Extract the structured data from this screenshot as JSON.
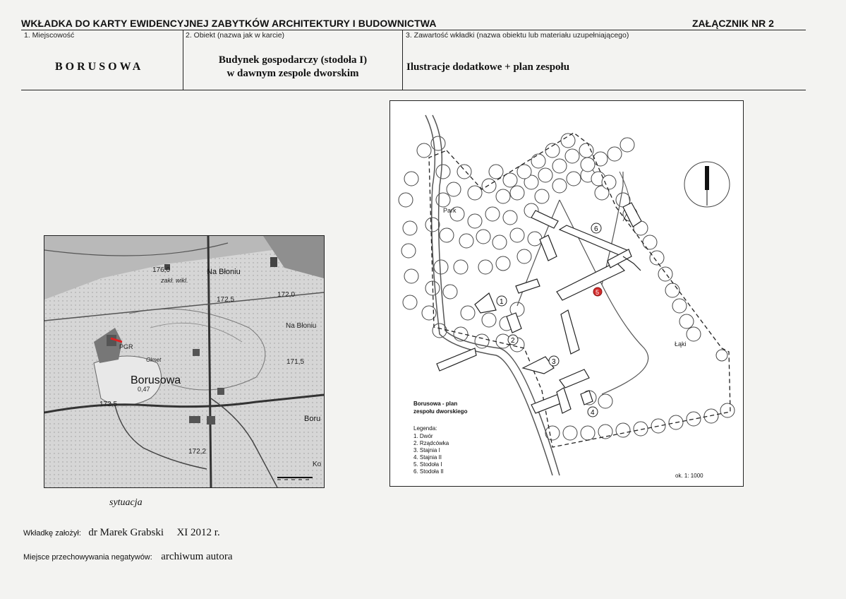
{
  "header": {
    "title": "WKŁADKA DO KARTY EWIDENCYJNEJ ZABYTKÓW ARCHITEKTURY I BUDOWNICTWA",
    "annex": "ZAŁĄCZNIK NR 2"
  },
  "fields": {
    "locality_label": "1. Miejscowość",
    "locality_value": "BORUSOWA",
    "object_label": "2. Obiekt (nazwa jak w karcie)",
    "object_line1": "Budynek gospodarczy (stodoła I)",
    "object_line2": "w dawnym zespole dworskim",
    "content_label": "3. Zawartość wkładki (nazwa obiektu lub materiału uzupełniającego)",
    "content_value": "Ilustracje dodatkowe + plan zespołu"
  },
  "situation_map": {
    "caption": "sytuacja",
    "labels": {
      "elev_176": "176,0",
      "zakl": "zakł. wikl.",
      "na_bloniu_1": "Na Błoniu",
      "elev_172_5a": "172,5",
      "elev_172_0": "172,0",
      "na_bloniu_2": "Na Błoniu",
      "pgr": "PGR",
      "olmet": "Olmet",
      "elev_171_5": "171,5",
      "borusowa": "Borusowa",
      "pop": "0,47",
      "elev_172_5b": "172,5",
      "boru": "Boru",
      "elev_172_2": "172,2",
      "ko": "Ko"
    }
  },
  "site_plan": {
    "park_label": "Park",
    "meadow_label": "Łąki",
    "numbers": [
      "1",
      "2",
      "3",
      "4",
      "5",
      "6"
    ],
    "title_line1": "Borusowa - plan",
    "title_line2": "zespołu dworskiego",
    "legend_title": "Legenda:",
    "legend": [
      "1. Dwór",
      "2. Rządcówka",
      "3. Stajnia I",
      "4. Stajnia II",
      "5. Stodoła I",
      "6. Stodoła II"
    ],
    "scale": "ok. 1: 1000",
    "highlight_color": "#d42a2a"
  },
  "footer": {
    "created_label": "Wkładkę założył:",
    "created_by": "dr Marek Grabski",
    "created_date": "XI 2012 r.",
    "storage_label": "Miejsce przechowywania negatywów:",
    "storage_value": "archiwum autora"
  }
}
